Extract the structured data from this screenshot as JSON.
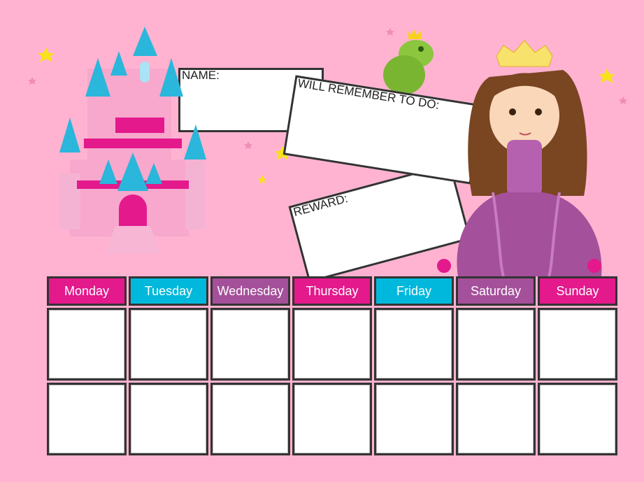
{
  "fields": {
    "name_label": "NAME:",
    "remember_label": "WILL REMEMBER TO DO:",
    "reward_label": "REWARD:"
  },
  "days": [
    {
      "label": "Monday",
      "color": "#e3198c"
    },
    {
      "label": "Tuesday",
      "color": "#00b8dc"
    },
    {
      "label": "Wednesday",
      "color": "#a4509a"
    },
    {
      "label": "Thursday",
      "color": "#e3198c"
    },
    {
      "label": "Friday",
      "color": "#00b8dc"
    },
    {
      "label": "Saturday",
      "color": "#a4509a"
    },
    {
      "label": "Sunday",
      "color": "#e3198c"
    }
  ],
  "rows": 2,
  "colors": {
    "background": "#ffb3d1",
    "border": "#333333"
  },
  "illustrations": [
    "castle",
    "frog-prince",
    "princess",
    "stars"
  ]
}
